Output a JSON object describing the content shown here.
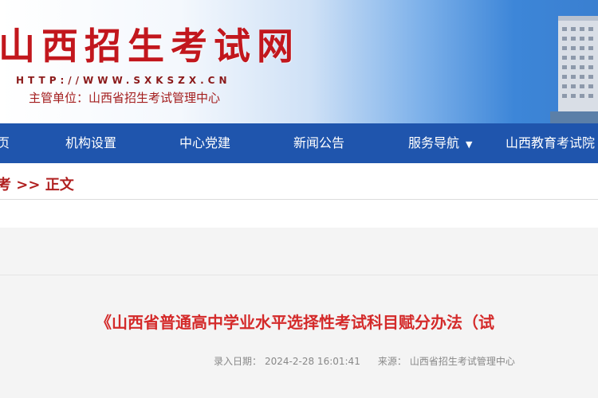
{
  "header": {
    "site_title": "山西招生考试网",
    "url": "HTTP://WWW.SXKSZX.CN",
    "host": "主管单位：山西省招生考试管理中心"
  },
  "nav": {
    "items": [
      {
        "label": "页"
      },
      {
        "label": "机构设置"
      },
      {
        "label": "中心党建"
      },
      {
        "label": "新闻公告"
      },
      {
        "label": "服务导航"
      },
      {
        "label": "山西教育考试院"
      }
    ]
  },
  "breadcrumb": {
    "text": "考 >> 正文"
  },
  "article": {
    "title": "《山西省普通高中学业水平选择性考试科目赋分办法（试",
    "date_label": "录入日期：",
    "date": "2024-2-28 16:01:41",
    "source_label": "来源：",
    "source": "山西省招生考试管理中心"
  },
  "colors": {
    "title_red": "#c2171d",
    "nav_blue": "#1f55ad",
    "article_red": "#d42a2a"
  }
}
